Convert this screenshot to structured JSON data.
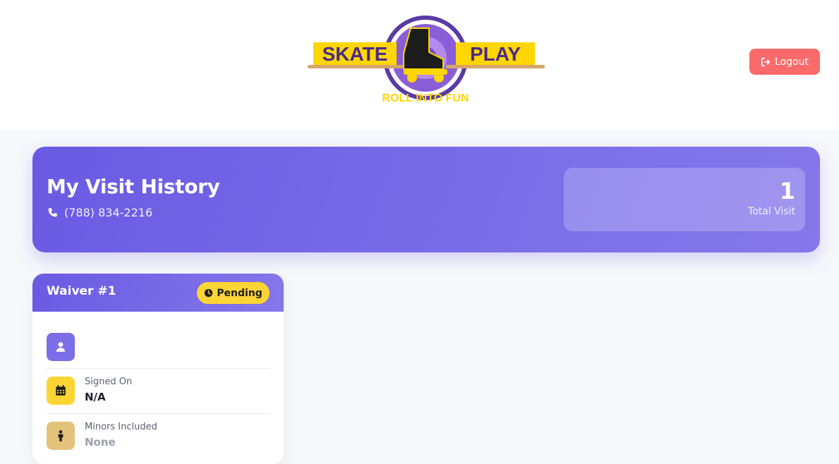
{
  "header": {
    "logo": {
      "brand_left": "SKATE",
      "brand_right": "PLAY",
      "tagline": "ROLL INTO FUN"
    },
    "logout_label": "Logout"
  },
  "hero": {
    "title": "My Visit History",
    "phone": "(788) 834-2216",
    "stat_value": "1",
    "stat_label": "Total Visit"
  },
  "waiver": {
    "title": "Waiver #1",
    "status": "Pending",
    "fields": [
      {
        "label": "",
        "value": "",
        "icon": "user-icon"
      },
      {
        "label": "Signed On",
        "value": "N/A",
        "icon": "calendar-icon"
      },
      {
        "label": "Minors Included",
        "value": "None",
        "icon": "child-icon"
      }
    ]
  },
  "colors": {
    "primary": "#6a5ae3",
    "logout": "#fa6a6a",
    "badge": "#fcd535",
    "calendar_icon_bg": "#fcd535",
    "child_icon_bg": "#e3c27a"
  }
}
